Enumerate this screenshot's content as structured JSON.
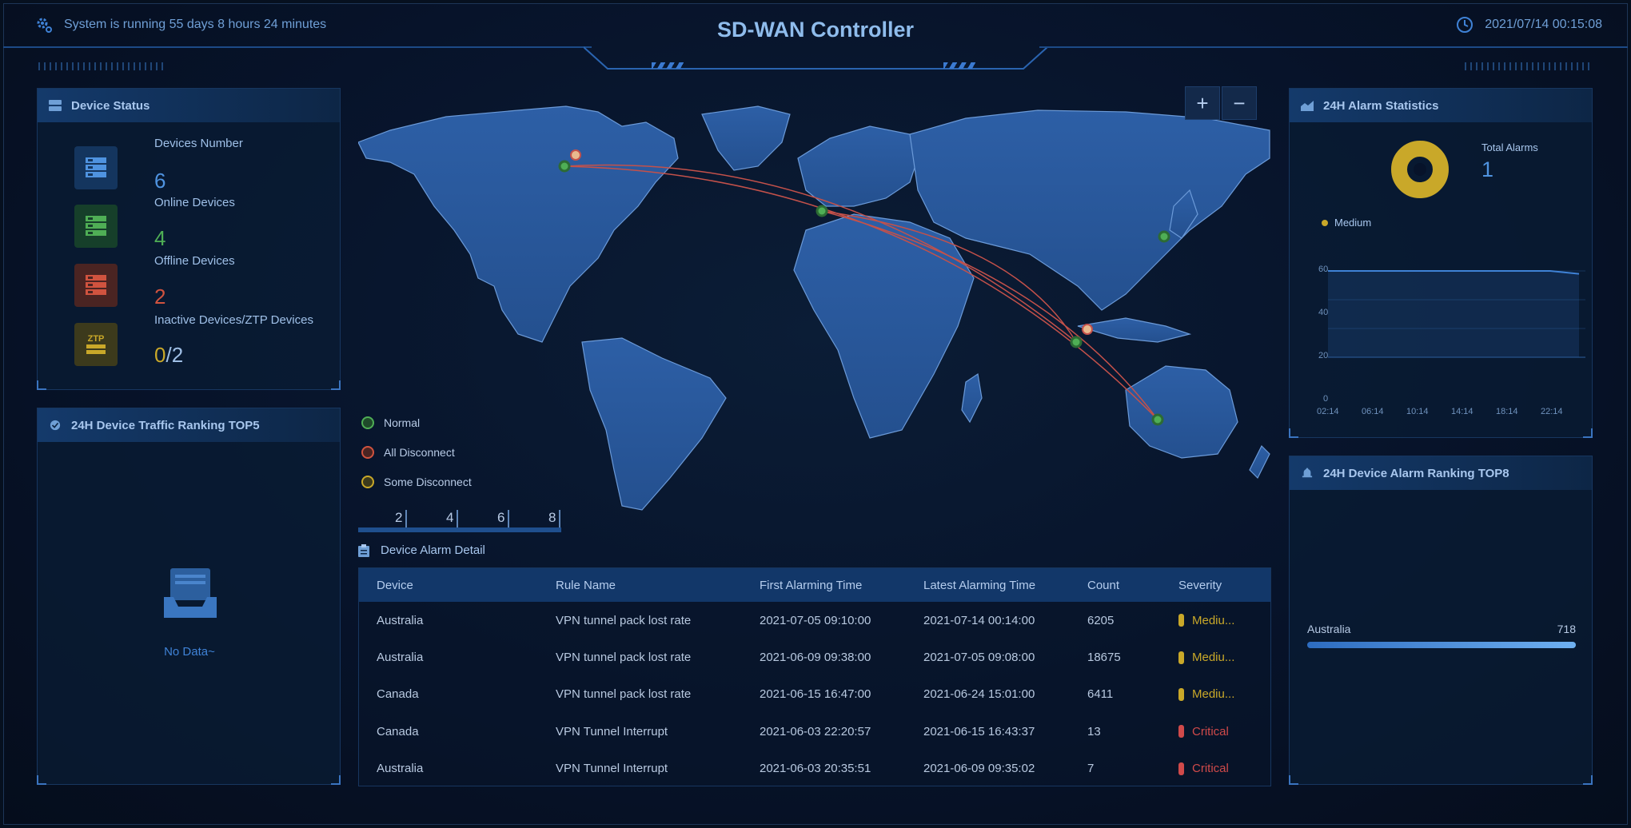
{
  "header": {
    "uptime": "System is running 55 days 8 hours 24 minutes",
    "title": "SD-WAN Controller",
    "datetime": "2021/07/14 00:15:08"
  },
  "device_status": {
    "title": "Device Status",
    "items": [
      {
        "label": "Devices Number",
        "value": "6",
        "color": "#4f93e0",
        "icon": "server-icon"
      },
      {
        "label": "Online Devices",
        "value": "4",
        "color": "#4fae55",
        "icon": "server-online-icon"
      },
      {
        "label": "Offline Devices",
        "value": "2",
        "color": "#d0533f",
        "icon": "server-offline-icon"
      },
      {
        "label": "Inactive Devices/ZTP Devices",
        "value_a": "0",
        "value_sep": "/",
        "value_b": "2",
        "color": "#c9a829",
        "icon": "ztp-icon",
        "icon_text": "ZTP"
      }
    ]
  },
  "traffic_ranking": {
    "title": "24H Device Traffic Ranking TOP5",
    "empty_text": "No Data~"
  },
  "map": {
    "zoom_in": "+",
    "zoom_out": "−",
    "legend": [
      {
        "label": "Normal",
        "color": "#4fae55"
      },
      {
        "label": "All Disconnect",
        "color": "#d0533f"
      },
      {
        "label": "Some Disconnect",
        "color": "#c9a829"
      }
    ],
    "scale": [
      "2",
      "4",
      "6",
      "8"
    ]
  },
  "alarm_detail": {
    "title": "Device Alarm Detail",
    "columns": [
      "Device",
      "Rule Name",
      "First Alarming Time",
      "Latest Alarming Time",
      "Count",
      "Severity"
    ],
    "rows": [
      {
        "device": "Australia",
        "rule": "VPN tunnel pack lost rate",
        "first": "2021-07-05 09:10:00",
        "latest": "2021-07-14 00:14:00",
        "count": "6205",
        "severity": "Mediu...",
        "sev_color": "#c9a829"
      },
      {
        "device": "Australia",
        "rule": "VPN tunnel pack lost rate",
        "first": "2021-06-09 09:38:00",
        "latest": "2021-07-05 09:08:00",
        "count": "18675",
        "severity": "Mediu...",
        "sev_color": "#c9a829"
      },
      {
        "device": "Canada",
        "rule": "VPN tunnel pack lost rate",
        "first": "2021-06-15 16:47:00",
        "latest": "2021-06-24 15:01:00",
        "count": "6411",
        "severity": "Mediu...",
        "sev_color": "#c9a829"
      },
      {
        "device": "Canada",
        "rule": "VPN Tunnel Interrupt",
        "first": "2021-06-03 22:20:57",
        "latest": "2021-06-15 16:43:37",
        "count": "13",
        "severity": "Critical",
        "sev_color": "#d04a4a"
      },
      {
        "device": "Australia",
        "rule": "VPN Tunnel Interrupt",
        "first": "2021-06-03 20:35:51",
        "latest": "2021-06-09 09:35:02",
        "count": "7",
        "severity": "Critical",
        "sev_color": "#d04a4a"
      }
    ]
  },
  "alarm_stats": {
    "title": "24H Alarm Statistics",
    "total_label": "Total Alarms",
    "total_value": "1",
    "legend_label": "Medium",
    "legend_color": "#c9a829",
    "y_ticks": [
      "60",
      "40",
      "20",
      "0"
    ],
    "x_ticks": [
      "02:14",
      "06:14",
      "10:14",
      "14:14",
      "18:14",
      "22:14"
    ]
  },
  "chart_data": {
    "type": "area",
    "y_ticks": [
      0,
      20,
      40,
      60
    ],
    "x_ticks": [
      "02:14",
      "06:14",
      "10:14",
      "14:14",
      "18:14",
      "22:14"
    ],
    "ylim": [
      0,
      60
    ],
    "x": [
      "02:14",
      "22:14",
      "23:59"
    ],
    "values": [
      60,
      60,
      58
    ]
  },
  "alarm_ranking": {
    "title": "24H Device Alarm Ranking TOP8",
    "items": [
      {
        "name": "Australia",
        "value": "718",
        "fraction": 1.0
      }
    ]
  }
}
